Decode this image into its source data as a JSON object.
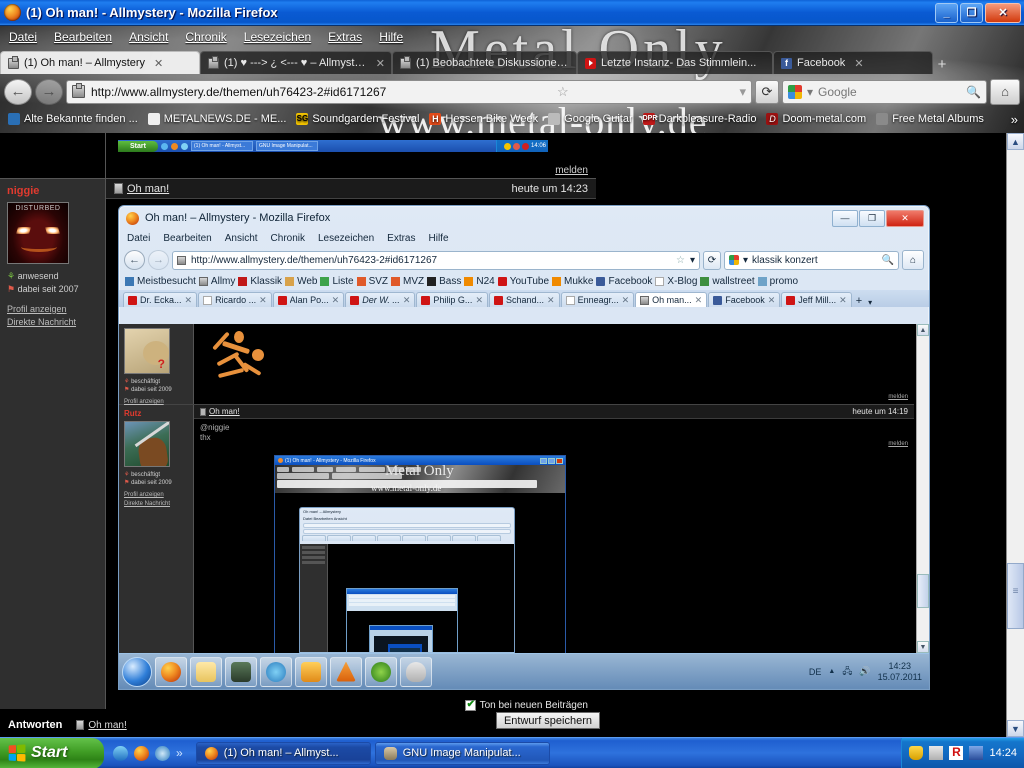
{
  "outer_window": {
    "title": "(1) Oh man! - Allmystery - Mozilla Firefox",
    "window_buttons": {
      "minimize": "_",
      "maximize": "❐",
      "close": "✕"
    },
    "menu": [
      "Datei",
      "Bearbeiten",
      "Ansicht",
      "Chronik",
      "Lesezeichen",
      "Extras",
      "Hilfe"
    ],
    "tabs": [
      {
        "label": "(1) Oh man! – Allmystery",
        "icon": "allmystery-icon",
        "active": true,
        "close": "✕"
      },
      {
        "label": "(1) ♥ ---> ¿ <--- ♥ – Allmystery",
        "icon": "allmystery-icon",
        "active": false,
        "close": "✕"
      },
      {
        "label": "(1) Beobachtete Diskussionen...",
        "icon": "allmystery-icon",
        "active": false,
        "close": "✕"
      },
      {
        "label": "Letzte Instanz- Das Stimmlein...",
        "icon": "youtube-icon",
        "active": false,
        "close": "✕"
      },
      {
        "label": "Facebook",
        "icon": "facebook-icon",
        "active": false,
        "close": "✕"
      }
    ],
    "new_tab_label": "+",
    "nav": {
      "back": "←",
      "forward": "→",
      "reload": "⟳",
      "home": "⌂",
      "star": "☆",
      "dropdown": "▾"
    },
    "url": "http://www.allmystery.de/themen/uh76423-2#id6171267",
    "search_placeholder": "Google",
    "search_engine": "google-icon",
    "bookmarks": [
      {
        "label": "Alte Bekannte finden ...",
        "icon": "network-icon"
      },
      {
        "label": "METALNEWS.DE - ME...",
        "icon": "skull-icon"
      },
      {
        "label": "Soundgarden Festival",
        "icon": "sg-icon"
      },
      {
        "label": "Hessen Bike Week",
        "icon": "h-icon"
      },
      {
        "label": "Google Guitar",
        "icon": "guitar-icon"
      },
      {
        "label": "Darkpleasure-Radio",
        "icon": "dpr-icon"
      },
      {
        "label": "Doom-metal.com",
        "icon": "d-icon"
      },
      {
        "label": "Free Metal Albums",
        "icon": "album-icon"
      }
    ],
    "bookmarks_overflow": "»",
    "watermark_line1": "Metal Only",
    "watermark_line2": "www.metal-only.de"
  },
  "page": {
    "top_melden": "melden",
    "post": {
      "username": "niggie",
      "avatar": "disturbed-avatar",
      "avatar_caption": "DISTURBED",
      "status": "anwesend",
      "member_since": "dabei seit 2007",
      "links": [
        "Profil anzeigen",
        "Direkte Nachricht"
      ],
      "thread_title": "Oh man!",
      "time": "heute um 14:23",
      "melden": "melden"
    },
    "reply": {
      "label": "Antworten",
      "thread_title": "Oh man!",
      "sound_checkbox_label": "Ton bei neuen Beiträgen",
      "sound_checked": true,
      "draft_button": "Entwurf speichern"
    }
  },
  "inner_window": {
    "xp_strip": {
      "start": "Start",
      "tasks": [
        "(1) Oh man! - Allmyst...",
        "GNU Image Manipulat..."
      ],
      "clock": "14:06"
    },
    "title": "Oh man! – Allmystery - Mozilla Firefox",
    "window_buttons": {
      "minimize": "—",
      "maximize": "❐",
      "close": "✕"
    },
    "menu": [
      "Datei",
      "Bearbeiten",
      "Ansicht",
      "Chronik",
      "Lesezeichen",
      "Extras",
      "Hilfe"
    ],
    "nav": {
      "back": "←",
      "forward": "→",
      "reload": "⟳",
      "home": "⌂",
      "star": "☆",
      "dropdown": "▾"
    },
    "url": "http://www.allmystery.de/themen/uh76423-2#id6171267",
    "search_value": "klassik konzert",
    "search_icon": "search-icon",
    "bookmarks": [
      {
        "label": "Meistbesucht",
        "icon": "most-visited-icon"
      },
      {
        "label": "Allmy",
        "icon": "allmystery-icon"
      },
      {
        "label": "Klassik",
        "icon": "klassik-icon"
      },
      {
        "label": "Web",
        "icon": "web-icon"
      },
      {
        "label": "Liste",
        "icon": "liste-icon"
      },
      {
        "label": "SVZ",
        "icon": "svz-icon"
      },
      {
        "label": "MVZ",
        "icon": "mvz-icon"
      },
      {
        "label": "Bass",
        "icon": "bass-icon"
      },
      {
        "label": "N24",
        "icon": "n24-icon"
      },
      {
        "label": "YouTube",
        "icon": "youtube-icon"
      },
      {
        "label": "Mukke",
        "icon": "mukke-icon"
      },
      {
        "label": "Facebook",
        "icon": "facebook-icon"
      },
      {
        "label": "X-Blog",
        "icon": "doc-icon"
      },
      {
        "label": "wallstreet",
        "icon": "wallstreet-icon"
      },
      {
        "label": "promo",
        "icon": "promo-icon"
      }
    ],
    "tabs": [
      {
        "label": "Dr. Ecka...",
        "icon": "youtube-icon",
        "active": false
      },
      {
        "label": "Ricardo ...",
        "icon": "doc-icon",
        "active": false
      },
      {
        "label": "Alan Po...",
        "icon": "youtube-icon",
        "active": false
      },
      {
        "label": "Der W. ...",
        "icon": "youtube-icon",
        "active": false
      },
      {
        "label": "Philip G...",
        "icon": "youtube-icon",
        "active": false
      },
      {
        "label": "Schand...",
        "icon": "youtube-icon",
        "active": false
      },
      {
        "label": "Enneagr...",
        "icon": "doc-icon",
        "active": false
      },
      {
        "label": "Oh man...",
        "icon": "allmystery-icon",
        "active": true
      },
      {
        "label": "Facebook",
        "icon": "facebook-icon",
        "active": false
      },
      {
        "label": "Jeff Mill...",
        "icon": "youtube-icon",
        "active": false
      }
    ],
    "new_tab_label": "+",
    "tab_overflow": "▾",
    "page_posts": [
      {
        "username": "",
        "avatar": "frog-avatar",
        "status": "beschäftigt",
        "member_since": "dabei seit 2009",
        "links": [
          "Profil anzeigen",
          "Direkte Nachricht"
        ],
        "melden": "melden"
      },
      {
        "username": "Rutz",
        "avatar": "rutz-avatar",
        "status": "beschäftigt",
        "member_since": "dabei seit 2009",
        "links": [
          "Profil anzeigen",
          "Direkte Nachricht"
        ],
        "thread_title": "Oh man!",
        "time": "heute um 14:19",
        "text_line1": "@niggie",
        "text_line2": "thx",
        "melden": "melden"
      }
    ],
    "taskbar": {
      "orb": "windows-start-orb",
      "items": [
        "firefox-icon",
        "explorer-icon",
        "computer-icon",
        "dreamweaver-icon",
        "winamp-icon",
        "vlc-icon",
        "icq-icon",
        "paint-icon"
      ],
      "tray_lang": "DE",
      "tray_icons": [
        "show-hidden-icon",
        "network-icon",
        "volume-icon"
      ],
      "clock_time": "14:23",
      "clock_date": "15.07.2011"
    }
  },
  "deep_window": {
    "title": "(1) Oh man! - Allmystery - Mozilla Firefox",
    "watermark1": "Metal Only",
    "watermark2": "www.metal-only.de"
  },
  "taskbar": {
    "start": "Start",
    "quick_launch": [
      "show-desktop-icon",
      "firefox-icon",
      "media-player-icon"
    ],
    "overflow": "»",
    "tasks": [
      {
        "label": "(1) Oh man! – Allmyst...",
        "icon": "firefox-icon",
        "active": true
      },
      {
        "label": "GNU Image Manipulat...",
        "icon": "gimp-icon",
        "active": false
      }
    ],
    "tray_icons": [
      "security-shield-icon",
      "network-disconnected-icon",
      "avira-icon",
      "display-icon"
    ],
    "clock": "14:24"
  },
  "colors": {
    "xp_blue": "#1f5fd0",
    "accent_red": "#e03a2f",
    "page_bg": "#000000",
    "sidebar_bg": "#2f2f2f"
  }
}
